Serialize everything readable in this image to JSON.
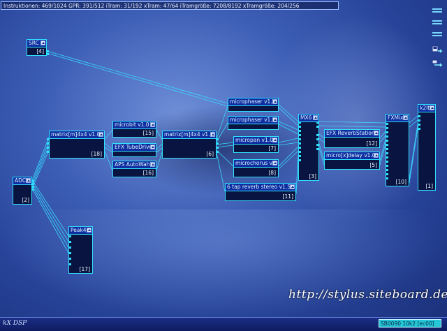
{
  "status_bar": "Instruktionen: 469/1024 GPR: 391/512 iTram: 31/192 xTram: 47/64 iTramgröße: 7208/8192 xTramgröße: 204/256",
  "side_toolbar": [
    "menu-icon",
    "menu-icon",
    "menu-icon",
    "load-icon",
    "connect-icon"
  ],
  "nodes": {
    "src": {
      "title": "SRC",
      "num": "[4]"
    },
    "adc": {
      "title": "ADC",
      "num": "[2]"
    },
    "matrix1": {
      "title": "matrix[m]4x4 v1.0",
      "num": "[18]"
    },
    "microbit": {
      "title": "microbit v1.0",
      "num": "[15]"
    },
    "tubedrive": {
      "title": "EFX TubeDrive",
      "num": ""
    },
    "autowah": {
      "title": "APS AutoWah",
      "num": "[16]"
    },
    "matrix2": {
      "title": "matrix[m]4x4 v1.0",
      "num": "[6]"
    },
    "phaser1": {
      "title": "microphaser v1.0",
      "num": ""
    },
    "phaser2": {
      "title": "microphaser v1.0",
      "num": ""
    },
    "micropan": {
      "title": "micropan v1.0",
      "num": "[7]"
    },
    "chorus": {
      "title": "microchorus v1.0",
      "num": "[8]"
    },
    "reverb6": {
      "title": "6 tap reverb stereo v1.5",
      "num": "[11]"
    },
    "mx6": {
      "title": "MX6",
      "num": "[3]"
    },
    "reverbstation": {
      "title": "EFX ReverbStation",
      "num": "[12]"
    },
    "delay": {
      "title": "micro[x]delay v1.0",
      "num": "[5]"
    },
    "fxmix": {
      "title": "FXMix",
      "num": "[10]"
    },
    "k2lt": {
      "title": "k2lt",
      "num": "[1]"
    },
    "peak4": {
      "title": "Peak4",
      "num": "[17]"
    }
  },
  "watermark": "http://stylus.siteboard.de",
  "logo": "kX DSP",
  "device": "SB0090 10k2 [ec00]"
}
